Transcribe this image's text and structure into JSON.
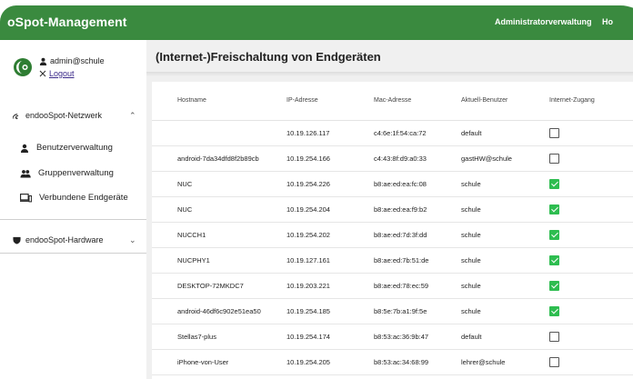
{
  "app": {
    "title": "oSpot-Management",
    "nav": [
      {
        "label": "Administratorverwaltung"
      },
      {
        "label": "Ho"
      }
    ]
  },
  "sidebar": {
    "user": "admin@schule",
    "logout": "Logout",
    "network_section": "endooSpot-Netzwerk",
    "items": [
      {
        "label": "Benutzerverwaltung"
      },
      {
        "label": "Gruppenverwaltung"
      },
      {
        "label": "Verbundene Endgeräte"
      }
    ],
    "hardware_section": "endooSpot-Hardware"
  },
  "main": {
    "title": "(Internet-)Freischaltung von Endgeräten",
    "columns": [
      "Hostname",
      "IP-Adresse",
      "Mac-Adresse",
      "Aktuell-Benutzer",
      "Internet-Zugang"
    ],
    "rows": [
      {
        "host": "",
        "ip": "10.19.126.117",
        "mac": "c4:6e:1f:54:ca:72",
        "user": "default",
        "access": false
      },
      {
        "host": "android-7da34dfd8f2b89cb",
        "ip": "10.19.254.166",
        "mac": "c4:43:8f:d9:a0:33",
        "user": "gastHW@schule",
        "access": false
      },
      {
        "host": "NUC",
        "ip": "10.19.254.226",
        "mac": "b8:ae:ed:ea:fc:08",
        "user": "schule",
        "access": true
      },
      {
        "host": "NUC",
        "ip": "10.19.254.204",
        "mac": "b8:ae:ed:ea:f9:b2",
        "user": "schule",
        "access": true
      },
      {
        "host": "NUCCH1",
        "ip": "10.19.254.202",
        "mac": "b8:ae:ed:7d:3f:dd",
        "user": "schule",
        "access": true
      },
      {
        "host": "NUCPHY1",
        "ip": "10.19.127.161",
        "mac": "b8:ae:ed:7b:51:de",
        "user": "schule",
        "access": true
      },
      {
        "host": "DESKTOP-72MKDC7",
        "ip": "10.19.203.221",
        "mac": "b8:ae:ed:78:ec:59",
        "user": "schule",
        "access": true
      },
      {
        "host": "android-46df6c902e51ea50",
        "ip": "10.19.254.185",
        "mac": "b8:5e:7b:a1:9f:5e",
        "user": "schule",
        "access": true
      },
      {
        "host": "Stellas7-plus",
        "ip": "10.19.254.174",
        "mac": "b8:53:ac:36:9b:47",
        "user": "default",
        "access": false
      },
      {
        "host": "iPhone-von-User",
        "ip": "10.19.254.205",
        "mac": "b8:53:ac:34:68:99",
        "user": "lehrer@schule",
        "access": false
      }
    ]
  },
  "colors": {
    "brand_green": "#3a8a3f",
    "check_green": "#2ebd50"
  },
  "icons": {
    "user": "person-icon",
    "logout": "close-icon",
    "network": "wifi-icon",
    "users": "person-icon",
    "groups": "group-icon",
    "devices": "devices-icon",
    "hardware": "shield-icon",
    "expand": "chevron-icon"
  }
}
